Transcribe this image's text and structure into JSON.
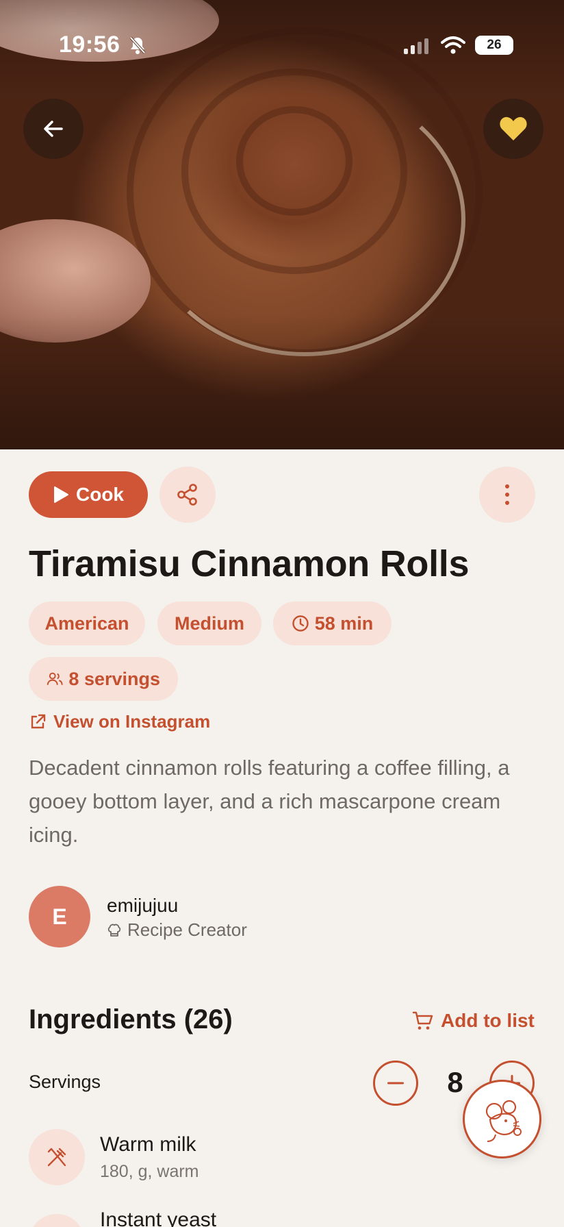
{
  "status_bar": {
    "time": "19:56",
    "battery": "26"
  },
  "recipe": {
    "cook_label": "Cook",
    "title": "Tiramisu Cinnamon Rolls",
    "cuisine": "American",
    "difficulty": "Medium",
    "time": "58 min",
    "servings_chip": "8 servings",
    "source_link": "View on Instagram",
    "description": "Decadent cinnamon rolls featuring a coffee filling, a gooey bottom layer, and a rich mascarpone cream icing."
  },
  "author": {
    "initial": "E",
    "name": "emijujuu",
    "role": "Recipe Creator"
  },
  "ingredients": {
    "title": "Ingredients (26)",
    "add_to_list": "Add to list",
    "servings_label": "Servings",
    "servings_value": "8",
    "items": [
      {
        "name": "Warm milk",
        "qty": "180, g, warm"
      },
      {
        "name": "Instant yeast",
        "qty": ""
      }
    ]
  },
  "colors": {
    "accent": "#cf5536",
    "chip_bg": "#f7e1d9",
    "favorite": "#f2c94c",
    "page_bg": "#f5f2ee"
  },
  "icons": [
    "back-arrow-icon",
    "heart-icon",
    "play-icon",
    "share-icon",
    "more-vertical-icon",
    "clock-icon",
    "people-icon",
    "external-link-icon",
    "chef-hat-icon",
    "cart-icon",
    "minus-icon",
    "plus-icon",
    "utensils-icon",
    "mouse-mascot-icon"
  ]
}
